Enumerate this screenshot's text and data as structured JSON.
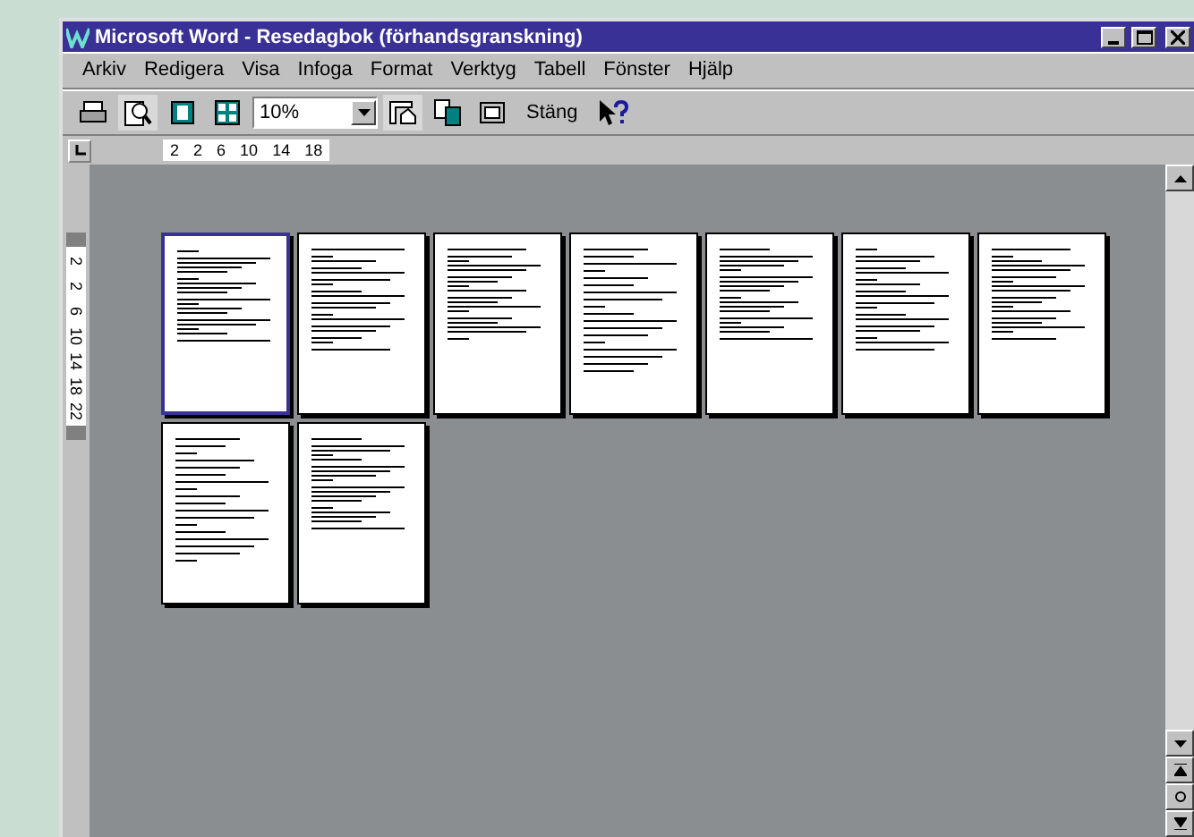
{
  "window": {
    "title": "Microsoft Word - Resedagbok (förhandsgranskning)"
  },
  "menu": [
    "Arkiv",
    "Redigera",
    "Visa",
    "Infoga",
    "Format",
    "Verktyg",
    "Tabell",
    "Fönster",
    "Hjälp"
  ],
  "toolbar": [
    {
      "kind": "print"
    },
    {
      "kind": "magnifier",
      "pressed": true
    },
    {
      "kind": "one-page",
      "pressed": false
    },
    {
      "kind": "multi-page",
      "pressed": false
    },
    {
      "kind": "zoom",
      "value": "10%"
    },
    {
      "kind": "ruler",
      "pressed": true
    },
    {
      "kind": "shrink",
      "pressed": false
    },
    {
      "kind": "fullscreen",
      "pressed": false
    },
    {
      "kind": "text",
      "label": "Stäng"
    },
    {
      "kind": "help"
    }
  ],
  "ruler": {
    "horizontal": [
      "2",
      "2",
      "6",
      "10",
      "14",
      "18"
    ],
    "vertical": [
      "2",
      "2",
      "6",
      "10",
      "14",
      "18",
      "22"
    ]
  },
  "pages": [
    {
      "selected": true
    },
    {
      "selected": false
    },
    {
      "selected": false
    },
    {
      "selected": false
    },
    {
      "selected": false
    },
    {
      "selected": false
    },
    {
      "selected": false
    },
    {
      "selected": false
    },
    {
      "selected": false
    }
  ]
}
